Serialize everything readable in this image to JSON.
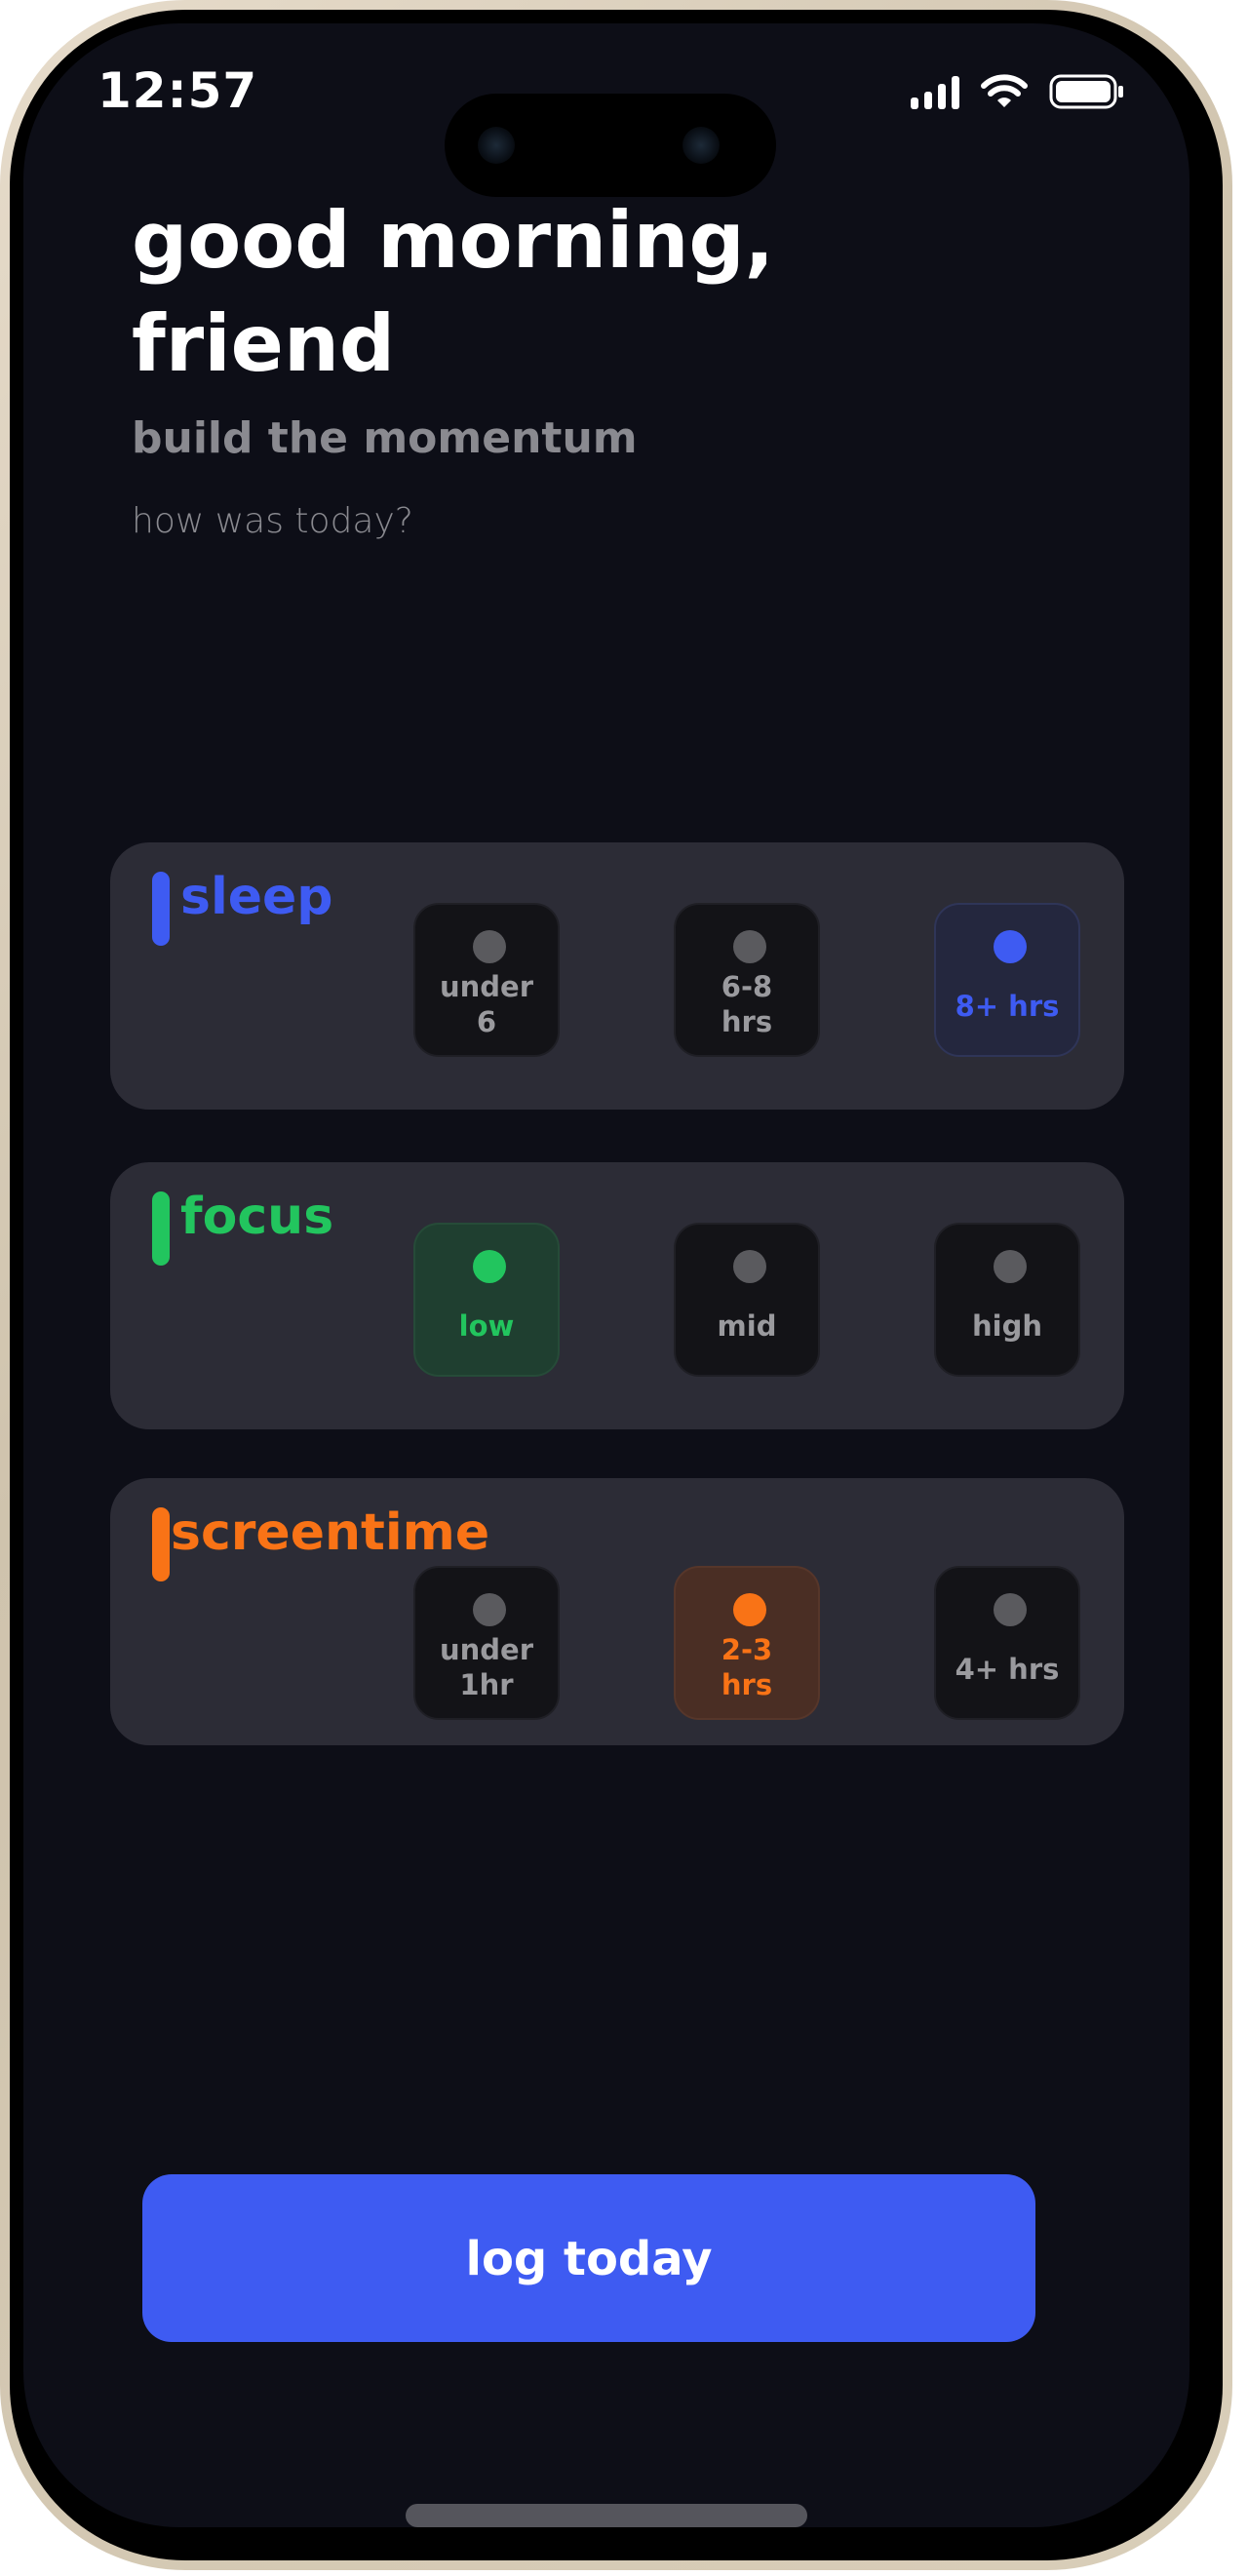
{
  "status_bar": {
    "time": "12:57"
  },
  "header": {
    "greeting": "good morning, friend",
    "subtitle": "build the momentum",
    "prompt": "how was today?"
  },
  "cards": [
    {
      "id": "sleep",
      "title": "sleep",
      "color": "#3e5bf2",
      "selected_index": 2,
      "options": [
        {
          "line1": "under",
          "line2": "6"
        },
        {
          "line1": "6-8",
          "line2": "hrs"
        },
        {
          "line1": "8+ hrs",
          "line2": ""
        }
      ]
    },
    {
      "id": "focus",
      "title": "focus",
      "color": "#22c55e",
      "selected_index": 0,
      "options": [
        {
          "line1": "low",
          "line2": ""
        },
        {
          "line1": "mid",
          "line2": ""
        },
        {
          "line1": "high",
          "line2": ""
        }
      ]
    },
    {
      "id": "screentime",
      "title": "screentime",
      "color": "#f97316",
      "selected_index": 1,
      "options": [
        {
          "line1": "under",
          "line2": "1hr"
        },
        {
          "line1": "2-3",
          "line2": "hrs"
        },
        {
          "line1": "4+ hrs",
          "line2": ""
        }
      ]
    }
  ],
  "actions": {
    "log_label": "log today"
  },
  "icons": {
    "signal": "cellular-signal-icon",
    "wifi": "wifi-icon",
    "battery": "battery-icon"
  }
}
